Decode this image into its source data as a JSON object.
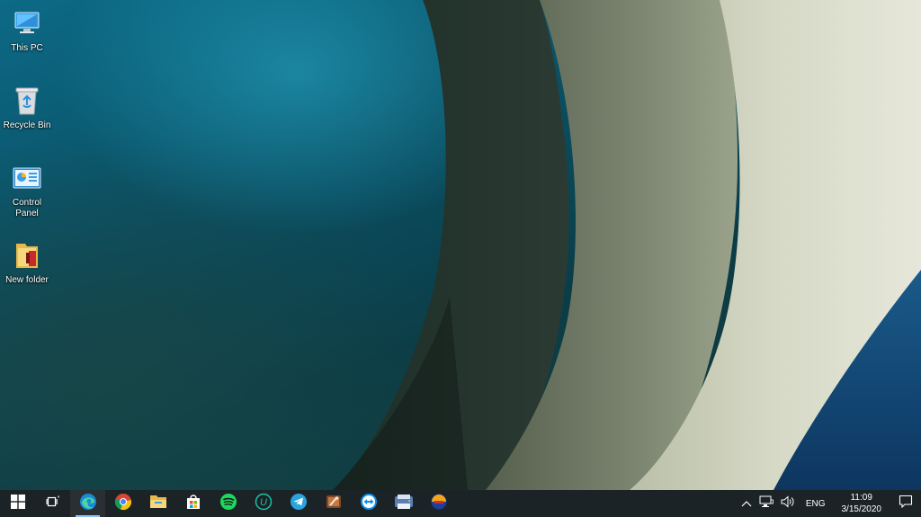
{
  "desktop": {
    "icons": [
      {
        "label": "This PC",
        "icon": "this-pc-icon"
      },
      {
        "label": "Recycle Bin",
        "icon": "recycle-bin-icon"
      },
      {
        "label": "Control Panel",
        "icon": "control-panel-icon"
      },
      {
        "label": "New folder",
        "icon": "folder-icon"
      }
    ]
  },
  "taskbar": {
    "apps": [
      {
        "icon": "windows-start-icon"
      },
      {
        "icon": "task-view-icon"
      },
      {
        "icon": "edge-icon",
        "active": true
      },
      {
        "icon": "chrome-icon"
      },
      {
        "icon": "file-explorer-icon"
      },
      {
        "icon": "microsoft-store-icon"
      },
      {
        "icon": "spotify-icon"
      },
      {
        "icon": "u-app-icon"
      },
      {
        "icon": "telegram-icon"
      },
      {
        "icon": "app-tools-icon"
      },
      {
        "icon": "teamviewer-icon"
      },
      {
        "icon": "app-printer-icon"
      },
      {
        "icon": "app-globe-icon"
      }
    ],
    "tray": {
      "language": "ENG",
      "time": "11:09",
      "date": "3/15/2020"
    }
  },
  "colors": {
    "taskbar": "#1c2326",
    "accent": "#8fc2ff"
  }
}
